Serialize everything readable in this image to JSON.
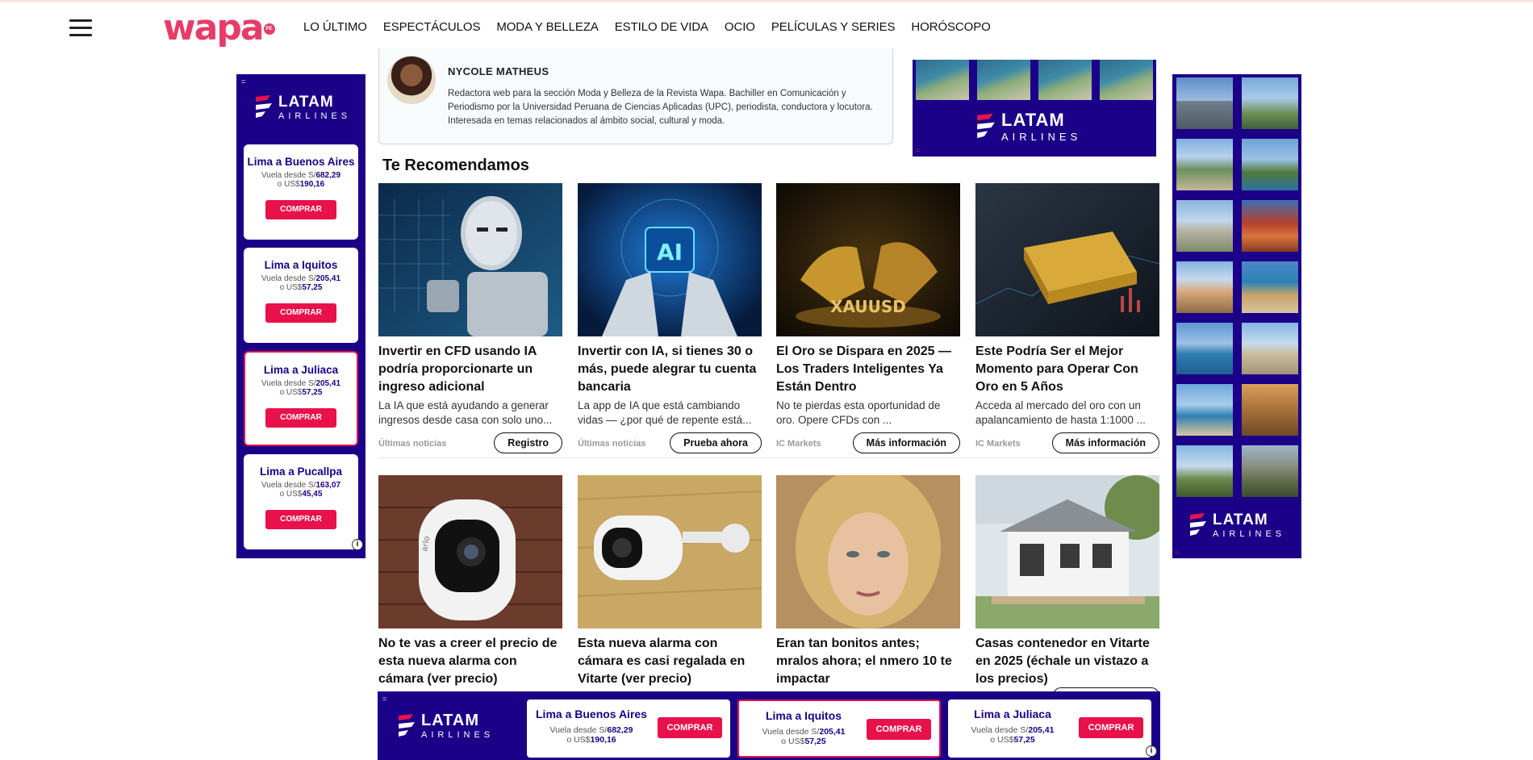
{
  "header": {
    "logo_text": "wapa",
    "logo_badge": "PE",
    "nav": [
      "LO ÚLTIMO",
      "ESPECTÁCULOS",
      "MODA Y BELLEZA",
      "ESTILO DE VIDA",
      "OCIO",
      "PELÍCULAS Y SERIES",
      "HORÓSCOPO"
    ]
  },
  "author": {
    "name": "NYCOLE MATHEUS",
    "bio": "Redactora web para la sección Moda y Belleza de la Revista Wapa. Bachiller en Comunicación y Periodismo por la Universidad Peruana de Ciencias Aplicadas (UPC), periodista, conductora y locutora. Interesada en temas relacionados al ámbito social, cultural y moda."
  },
  "recommend": {
    "title": "Te Recomendamos",
    "row1": [
      {
        "title": "Invertir en CFD usando IA podría proporcionarte un ingreso adicional",
        "desc": "La IA que está ayudando a generar ingresos desde casa con solo uno...",
        "source": "Últimas noticias",
        "button": "Registro"
      },
      {
        "title": "Invertir con IA, si tienes 30 o más, puede alegrar tu cuenta bancaria",
        "desc": "La app de IA que está cambiando vidas — ¿por qué de repente está...",
        "source": "Últimas noticias",
        "button": "Prueba ahora"
      },
      {
        "title": "El Oro se Dispara en 2025 — Los Traders Inteligentes Ya Están Dentro",
        "desc": "No te pierdas esta oportunidad de oro. Opere CFDs con ...",
        "source": "IC Markets",
        "button": "Más información"
      },
      {
        "title": "Este Podría Ser el Mejor Momento para Operar Con Oro en 5 Años",
        "desc": "Acceda al mercado del oro con un apalancamiento de hasta 1:1000 ...",
        "source": "IC Markets",
        "button": "Más información"
      }
    ],
    "row2": [
      {
        "title": "No te vas a creer el precio de esta nueva alarma con cámara (ver precio)"
      },
      {
        "title": "Esta nueva alarma con cámara es casi regalada en Vitarte (ver precio)"
      },
      {
        "title": "Eran tan bonitos antes; mralos ahora; el nmero 10 te impactar"
      },
      {
        "title": "Casas contenedor en Vitarte en 2025 (échale un vistazo a los precios)"
      }
    ],
    "thumb_labels": {
      "ai": "AI",
      "gold": "XAUUSD",
      "arlo": "arlo"
    }
  },
  "ads": {
    "brand_line1": "LATAM",
    "brand_line2": "AIRLINES",
    "buy": "COMPRAR",
    "ad_marker": "=",
    "info": "i",
    "left_routes": [
      {
        "name": "Lima a Buenos Aires",
        "prefix": "Vuela desde S/",
        "soles": "682,29",
        "usd_prefix": "o US$",
        "usd": "190,16"
      },
      {
        "name": "Lima a Iquitos",
        "prefix": "Vuela desde S/",
        "soles": "205,41",
        "usd_prefix": "o US$",
        "usd": "57,25"
      },
      {
        "name": "Lima a Juliaca",
        "prefix": "Vuela desde S/",
        "soles": "205,41",
        "usd_prefix": "o US$",
        "usd": "57,25"
      },
      {
        "name": "Lima a Pucallpa",
        "prefix": "Vuela desde S/",
        "soles": "163,07",
        "usd_prefix": "o US$",
        "usd": "45,45"
      }
    ],
    "bottom_routes": [
      {
        "name": "Lima a Buenos Aires",
        "prefix": "Vuela desde S/",
        "soles": "682,29",
        "usd_prefix": "o US$",
        "usd": "190,16"
      },
      {
        "name": "Lima a Iquitos",
        "prefix": "Vuela desde S/",
        "soles": "205,41",
        "usd_prefix": "o US$",
        "usd": "57,25"
      },
      {
        "name": "Lima a Juliaca",
        "prefix": "Vuela desde S/",
        "soles": "205,41",
        "usd_prefix": "o US$",
        "usd": "57,25"
      }
    ]
  },
  "colors": {
    "brand_pink": "#e73c68",
    "latam_blue": "#1b0088",
    "latam_red": "#e8114b"
  },
  "icons": [
    "hamburger-icon",
    "latam-logo-icon",
    "info-icon"
  ]
}
